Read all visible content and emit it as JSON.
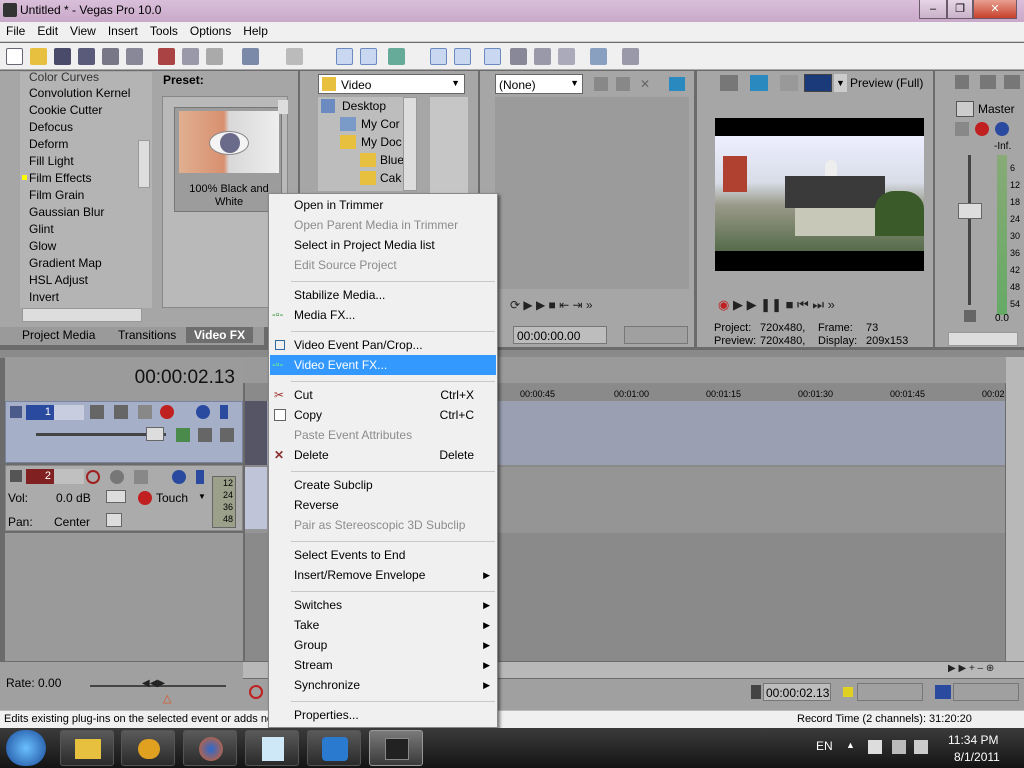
{
  "window": {
    "title": "Untitled * - Vegas Pro 10.0",
    "min_label": "–",
    "max_label": "❐",
    "close_label": "✕"
  },
  "menu": [
    "File",
    "Edit",
    "View",
    "Insert",
    "Tools",
    "Options",
    "Help"
  ],
  "fx_panel": {
    "items": [
      "Color Curves",
      "Convolution Kernel",
      "Cookie Cutter",
      "Defocus",
      "Deform",
      "Fill Light",
      "Film Effects",
      "Film Grain",
      "Gaussian Blur",
      "Glint",
      "Glow",
      "Gradient Map",
      "HSL Adjust",
      "Invert"
    ],
    "preset_label": "Preset:",
    "preset_name": "100% Black and White"
  },
  "explorer": {
    "dropdown": "Video",
    "items": [
      "Desktop",
      "My Cor",
      "My Doc",
      "Blue",
      "Cak"
    ]
  },
  "tabs": [
    "Project Media",
    "Transitions",
    "Video FX"
  ],
  "trimmer": {
    "dropdown": "(None)",
    "timecode": "00:00:00.00"
  },
  "preview": {
    "label": "Preview (Full)",
    "project_label": "Project:",
    "project_val": "720x480,",
    "frame_label": "Frame:",
    "frame_val": "73",
    "preview_label": "Preview:",
    "preview_val": "720x480,",
    "display_label": "Display:",
    "display_val": "209x153"
  },
  "master": {
    "title": "Master",
    "inf": "-Inf.",
    "scale": [
      "6",
      "12",
      "18",
      "24",
      "30",
      "36",
      "42",
      "48",
      "54"
    ],
    "bottom_left": "0.0",
    "bottom_right": "0.0"
  },
  "timeline": {
    "timecode": "00:00:02.13",
    "ruler": [
      "00:00:45",
      "00:01:00",
      "00:01:15",
      "00:01:30",
      "00:01:45",
      "00:02"
    ],
    "track1_num": "1",
    "track2_num": "2",
    "vol_label": "Vol:",
    "vol_val": "0.0 dB",
    "pan_label": "Pan:",
    "pan_val": "Center",
    "touch": "Touch",
    "meter": [
      "12",
      "24",
      "36",
      "48"
    ],
    "rate": "Rate: 0.00",
    "bottom_timecode": "00:00:02.13"
  },
  "context_menu": {
    "items": [
      {
        "label": "Open in Trimmer",
        "enabled": true
      },
      {
        "label": "Open Parent Media in Trimmer",
        "enabled": false
      },
      {
        "label": "Select in Project Media list",
        "enabled": true
      },
      {
        "label": "Edit Source Project",
        "enabled": false
      },
      {
        "label": "Stabilize Media...",
        "enabled": true
      },
      {
        "label": "Media FX...",
        "enabled": true
      },
      {
        "label": "Video Event Pan/Crop...",
        "enabled": true
      },
      {
        "label": "Video Event FX...",
        "enabled": true,
        "highlighted": true
      },
      {
        "label": "Cut",
        "shortcut": "Ctrl+X",
        "enabled": true
      },
      {
        "label": "Copy",
        "shortcut": "Ctrl+C",
        "enabled": true
      },
      {
        "label": "Paste Event Attributes",
        "enabled": false
      },
      {
        "label": "Delete",
        "shortcut": "Delete",
        "enabled": true
      },
      {
        "label": "Create Subclip",
        "enabled": true
      },
      {
        "label": "Reverse",
        "enabled": true
      },
      {
        "label": "Pair as Stereoscopic 3D Subclip",
        "enabled": false
      },
      {
        "label": "Select Events to End",
        "enabled": true
      },
      {
        "label": "Insert/Remove Envelope",
        "enabled": true,
        "submenu": true
      },
      {
        "label": "Switches",
        "enabled": true,
        "submenu": true
      },
      {
        "label": "Take",
        "enabled": true,
        "submenu": true
      },
      {
        "label": "Group",
        "enabled": true,
        "submenu": true
      },
      {
        "label": "Stream",
        "enabled": true,
        "submenu": true
      },
      {
        "label": "Synchronize",
        "enabled": true,
        "submenu": true
      },
      {
        "label": "Properties...",
        "enabled": true
      }
    ]
  },
  "status": {
    "text": "Edits existing plug-ins on the selected event or adds ne",
    "record": "Record Time (2 channels): 31:20:20"
  },
  "taskbar": {
    "lang": "EN",
    "time": "11:34 PM",
    "date": "8/1/2011"
  },
  "colors": {
    "highlight": "#3399ff",
    "title_bar": "#c9a9c9",
    "panel": "#a8a8a8",
    "taskbar": "#1e1e1e"
  }
}
